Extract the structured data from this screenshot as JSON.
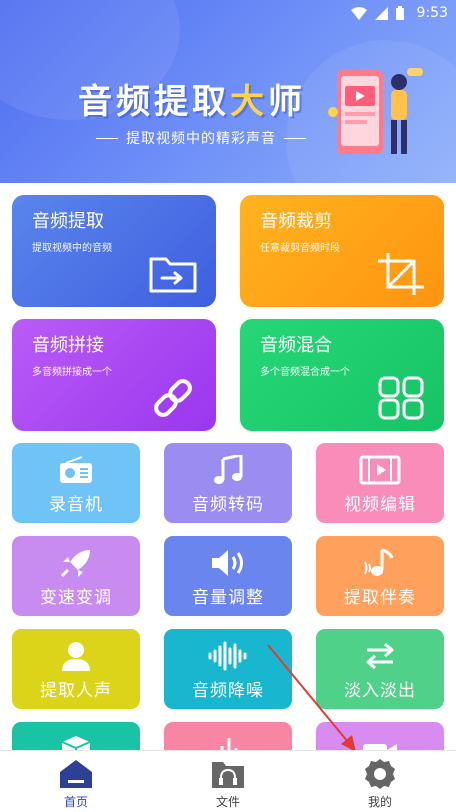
{
  "status": {
    "time": "9:53"
  },
  "banner": {
    "title_a": "音频提取",
    "title_b": "大",
    "title_c": "师",
    "subtitle": "提取视频中的精彩声音"
  },
  "features": [
    {
      "title": "音频提取",
      "desc": "提取视频中的音频",
      "color": "#4c72e8",
      "icon": "folder-import-icon"
    },
    {
      "title": "音频裁剪",
      "desc": "任意裁剪音频时段",
      "color": "#ffa31a",
      "icon": "crop-icon"
    },
    {
      "title": "音频拼接",
      "desc": "多音频拼接成一个",
      "color": "#a947f3",
      "icon": "link-icon"
    },
    {
      "title": "音频混合",
      "desc": "多个音频混合成一个",
      "color": "#1fce6e",
      "icon": "mix-grid-icon"
    }
  ],
  "tools": [
    {
      "label": "录音机",
      "color": "#6fc3f7",
      "icon": "radio-icon"
    },
    {
      "label": "音频转码",
      "color": "#9b8cf2",
      "icon": "music-note-icon"
    },
    {
      "label": "视频编辑",
      "color": "#f98cb8",
      "icon": "film-icon"
    },
    {
      "label": "变速变调",
      "color": "#c88cf0",
      "icon": "rocket-icon"
    },
    {
      "label": "音量调整",
      "color": "#6a86ee",
      "icon": "speaker-icon"
    },
    {
      "label": "提取伴奏",
      "color": "#ffa15c",
      "icon": "music-wave-icon"
    },
    {
      "label": "提取人声",
      "color": "#dcd419",
      "icon": "person-icon"
    },
    {
      "label": "音频降噪",
      "color": "#19b6cf",
      "icon": "waveform-icon"
    },
    {
      "label": "淡入淡出",
      "color": "#4fd189",
      "icon": "swap-icon"
    }
  ],
  "more_tools_colors": [
    "#19c3a3",
    "#f985a4",
    "#d88cf2"
  ],
  "tabs": [
    {
      "label": "首页",
      "icon": "home-icon",
      "active": true
    },
    {
      "label": "文件",
      "icon": "folder-headphones-icon",
      "active": false
    },
    {
      "label": "我的",
      "icon": "gear-icon",
      "active": false
    }
  ]
}
